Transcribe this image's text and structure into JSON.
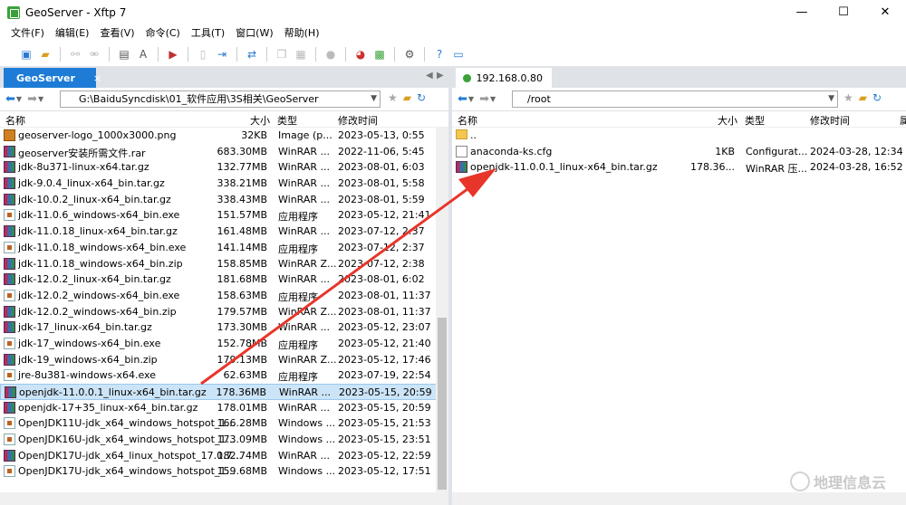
{
  "window": {
    "title": "GeoServer - Xftp 7",
    "minimize": "—",
    "maximize": "☐",
    "close": "✕"
  },
  "menu": [
    "文件(F)",
    "编辑(E)",
    "查看(V)",
    "命令(C)",
    "工具(T)",
    "窗口(W)",
    "帮助(H)"
  ],
  "left": {
    "tab_label": "GeoServer",
    "tab_close": "×",
    "path": "G:\\BaiduSyncdisk\\01_软件应用\\3S相关\\GeoServer",
    "columns": {
      "name": "名称",
      "size": "大小",
      "type": "类型",
      "modified": "修改时间"
    },
    "files": [
      {
        "name": "geoserver-logo_1000x3000.png",
        "size": "32KB",
        "type": "Image (p...",
        "modified": "2023-05-13, 0:55",
        "icon": "image-icon"
      },
      {
        "name": "geoserver安装所需文件.rar",
        "size": "683.30MB",
        "type": "WinRAR ...",
        "modified": "2022-11-06, 5:45",
        "icon": "rar-icon"
      },
      {
        "name": "jdk-8u371-linux-x64.tar.gz",
        "size": "132.77MB",
        "type": "WinRAR ...",
        "modified": "2023-08-01, 6:03",
        "icon": "rar-icon"
      },
      {
        "name": "jdk-9.0.4_linux-x64_bin.tar.gz",
        "size": "338.21MB",
        "type": "WinRAR ...",
        "modified": "2023-08-01, 5:58",
        "icon": "rar-icon"
      },
      {
        "name": "jdk-10.0.2_linux-x64_bin.tar.gz",
        "size": "338.43MB",
        "type": "WinRAR ...",
        "modified": "2023-08-01, 5:59",
        "icon": "rar-icon"
      },
      {
        "name": "jdk-11.0.6_windows-x64_bin.exe",
        "size": "151.57MB",
        "type": "应用程序",
        "modified": "2023-05-12, 21:41",
        "icon": "exe-icon"
      },
      {
        "name": "jdk-11.0.18_linux-x64_bin.tar.gz",
        "size": "161.48MB",
        "type": "WinRAR ...",
        "modified": "2023-07-12, 2:37",
        "icon": "rar-icon"
      },
      {
        "name": "jdk-11.0.18_windows-x64_bin.exe",
        "size": "141.14MB",
        "type": "应用程序",
        "modified": "2023-07-12, 2:37",
        "icon": "exe-icon"
      },
      {
        "name": "jdk-11.0.18_windows-x64_bin.zip",
        "size": "158.85MB",
        "type": "WinRAR Z...",
        "modified": "2023-07-12, 2:38",
        "icon": "rar-icon"
      },
      {
        "name": "jdk-12.0.2_linux-x64_bin.tar.gz",
        "size": "181.68MB",
        "type": "WinRAR ...",
        "modified": "2023-08-01, 6:02",
        "icon": "rar-icon"
      },
      {
        "name": "jdk-12.0.2_windows-x64_bin.exe",
        "size": "158.63MB",
        "type": "应用程序",
        "modified": "2023-08-01, 11:37",
        "icon": "exe-icon"
      },
      {
        "name": "jdk-12.0.2_windows-x64_bin.zip",
        "size": "179.57MB",
        "type": "WinRAR Z...",
        "modified": "2023-08-01, 11:37",
        "icon": "rar-icon"
      },
      {
        "name": "jdk-17_linux-x64_bin.tar.gz",
        "size": "173.30MB",
        "type": "WinRAR ...",
        "modified": "2023-05-12, 23:07",
        "icon": "rar-icon"
      },
      {
        "name": "jdk-17_windows-x64_bin.exe",
        "size": "152.78MB",
        "type": "应用程序",
        "modified": "2023-05-12, 21:40",
        "icon": "exe-icon"
      },
      {
        "name": "jdk-19_windows-x64_bin.zip",
        "size": "179.13MB",
        "type": "WinRAR Z...",
        "modified": "2023-05-12, 17:46",
        "icon": "rar-icon"
      },
      {
        "name": "jre-8u381-windows-x64.exe",
        "size": "62.63MB",
        "type": "应用程序",
        "modified": "2023-07-19, 22:54",
        "icon": "exe-icon"
      },
      {
        "name": "openjdk-11.0.0.1_linux-x64_bin.tar.gz",
        "size": "178.36MB",
        "type": "WinRAR ...",
        "modified": "2023-05-15, 20:59",
        "icon": "rar-icon",
        "selected": true
      },
      {
        "name": "openjdk-17+35_linux-x64_bin.tar.gz",
        "size": "178.01MB",
        "type": "WinRAR ...",
        "modified": "2023-05-15, 20:59",
        "icon": "rar-icon"
      },
      {
        "name": "OpenJDK11U-jdk_x64_windows_hotspot_1...",
        "size": "166.28MB",
        "type": "Windows ...",
        "modified": "2023-05-15, 21:53",
        "icon": "msi-icon"
      },
      {
        "name": "OpenJDK16U-jdk_x64_windows_hotspot_1...",
        "size": "173.09MB",
        "type": "Windows ...",
        "modified": "2023-05-15, 23:51",
        "icon": "msi-icon"
      },
      {
        "name": "OpenJDK17U-jdk_x64_linux_hotspot_17.0.7...",
        "size": "182.74MB",
        "type": "WinRAR ...",
        "modified": "2023-05-12, 22:59",
        "icon": "rar-icon"
      },
      {
        "name": "OpenJDK17U-jdk_x64_windows_hotspot_1...",
        "size": "159.68MB",
        "type": "Windows ...",
        "modified": "2023-05-12, 17:51",
        "icon": "msi-icon"
      }
    ]
  },
  "right": {
    "tab_label": "192.168.0.80",
    "path": "/root",
    "columns": {
      "name": "名称",
      "size": "大小",
      "type": "类型",
      "modified": "修改时间",
      "attr": "属"
    },
    "files": [
      {
        "name": "..",
        "size": "",
        "type": "",
        "modified": "",
        "icon": "folder-icon"
      },
      {
        "name": "anaconda-ks.cfg",
        "size": "1KB",
        "type": "Configurat...",
        "modified": "2024-03-28, 12:34",
        "icon": "cfg-icon"
      },
      {
        "name": "openjdk-11.0.0.1_linux-x64_bin.tar.gz",
        "size": "178.36...",
        "type": "WinRAR 压...",
        "modified": "2024-03-28, 16:52",
        "icon": "rar-icon"
      }
    ]
  },
  "watermark": "地理信息云",
  "colors": {
    "accent": "#1e7cd6",
    "selection": "#cce4f7",
    "annotation_arrow": "#e8352a"
  }
}
